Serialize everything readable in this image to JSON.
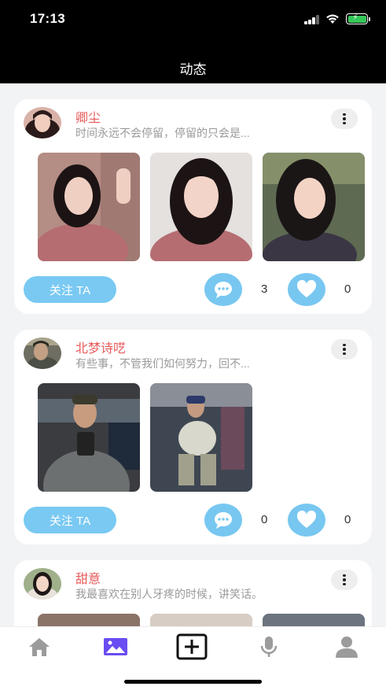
{
  "status_bar": {
    "time": "17:13"
  },
  "header": {
    "title": "动态"
  },
  "posts": [
    {
      "name": "卿尘",
      "bio": "时间永远不会停留，停留的只会是...",
      "follow_label": "关注 TA",
      "comments": "3",
      "likes": "0"
    },
    {
      "name": "北梦诗呓",
      "bio": "有些事，不管我们如何努力，回不...",
      "follow_label": "关注 TA",
      "comments": "0",
      "likes": "0"
    },
    {
      "name": "甜意",
      "bio": "我最喜欢在别人牙疼的时候，讲笑话。"
    }
  ],
  "tabs": [
    {
      "icon": "home-icon",
      "active": false
    },
    {
      "icon": "gallery-icon",
      "active": true,
      "color": "#6a4cf2"
    },
    {
      "icon": "add-post-icon",
      "active": false
    },
    {
      "icon": "microphone-icon",
      "active": false
    },
    {
      "icon": "profile-icon",
      "active": false
    }
  ],
  "colors": {
    "accent": "#78c7f1",
    "name": "#e85a5a",
    "active_tab": "#6a4cf2"
  }
}
